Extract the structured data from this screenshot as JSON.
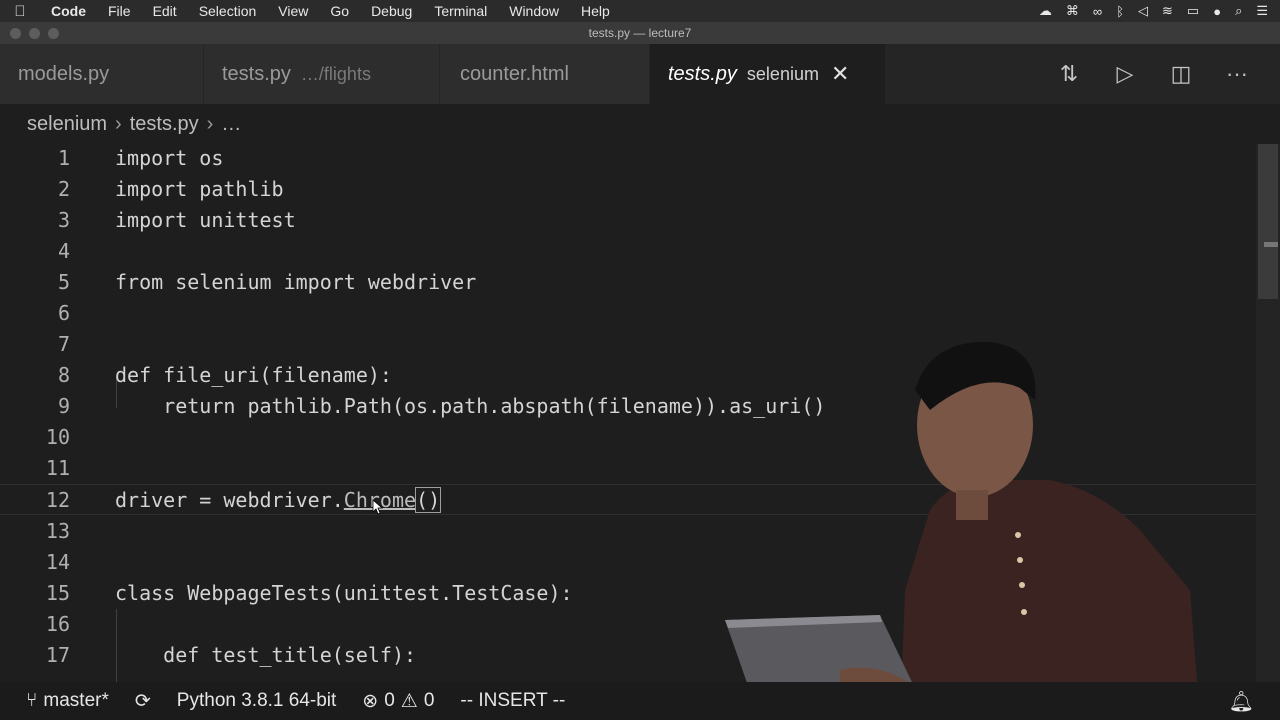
{
  "menubar": {
    "app": "Code",
    "items": [
      "File",
      "Edit",
      "Selection",
      "View",
      "Go",
      "Debug",
      "Terminal",
      "Window",
      "Help"
    ]
  },
  "window": {
    "title": "tests.py — lecture7"
  },
  "tabs": [
    {
      "name": "models.py",
      "desc": ""
    },
    {
      "name": "tests.py",
      "desc": "…/flights"
    },
    {
      "name": "counter.html",
      "desc": ""
    },
    {
      "name": "tests.py",
      "desc": "selenium",
      "active": true
    }
  ],
  "breadcrumb": {
    "folder": "selenium",
    "file": "tests.py",
    "more": "…"
  },
  "editor": {
    "lines": [
      {
        "n": "1",
        "text": "import os"
      },
      {
        "n": "2",
        "text": "import pathlib"
      },
      {
        "n": "3",
        "text": "import unittest"
      },
      {
        "n": "4",
        "text": ""
      },
      {
        "n": "5",
        "text": "from selenium import webdriver"
      },
      {
        "n": "6",
        "text": ""
      },
      {
        "n": "7",
        "text": ""
      },
      {
        "n": "8",
        "text": "def file_uri(filename):"
      },
      {
        "n": "9",
        "text": "    return pathlib.Path(os.path.abspath(filename)).as_uri()"
      },
      {
        "n": "10",
        "text": ""
      },
      {
        "n": "11",
        "text": ""
      },
      {
        "n": "12",
        "text": "driver = webdriver."
      },
      {
        "n": "13",
        "text": ""
      },
      {
        "n": "14",
        "text": ""
      },
      {
        "n": "15",
        "text": "class WebpageTests(unittest.TestCase):"
      },
      {
        "n": "16",
        "text": ""
      },
      {
        "n": "17",
        "text": "    def test_title(self):"
      }
    ],
    "line12_link": "Chrome",
    "line12_parens": "()"
  },
  "status": {
    "branch": "master*",
    "python": "Python 3.8.1 64-bit",
    "errors": "0",
    "warnings": "0",
    "mode": "-- INSERT --"
  }
}
